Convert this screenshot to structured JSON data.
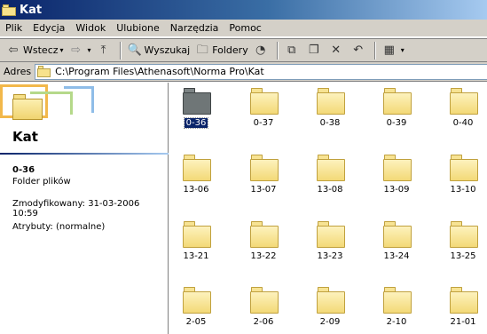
{
  "window": {
    "title": "Kat"
  },
  "menu": [
    {
      "label": "Plik"
    },
    {
      "label": "Edycja"
    },
    {
      "label": "Widok"
    },
    {
      "label": "Ulubione"
    },
    {
      "label": "Narzędzia"
    },
    {
      "label": "Pomoc"
    }
  ],
  "toolbar": {
    "back_label": "Wstecz",
    "search_label": "Wyszukaj",
    "folders_label": "Foldery"
  },
  "address": {
    "label": "Adres",
    "value": "C:\\Program Files\\Athenasoft\\Norma Pro\\Kat"
  },
  "details": {
    "folder_name": "Kat",
    "selected_name": "0-36",
    "selected_type": "Folder plików",
    "modified": "Zmodyfikowany: 31-03-2006 10:59",
    "attributes": "Atrybuty: (normalne)"
  },
  "folders": [
    [
      "0-36",
      "0-37",
      "0-38",
      "0-39",
      "0-40"
    ],
    [
      "13-06",
      "13-07",
      "13-08",
      "13-09",
      "13-10"
    ],
    [
      "13-21",
      "13-22",
      "13-23",
      "13-24",
      "13-25"
    ],
    [
      "2-05",
      "2-06",
      "2-09",
      "2-10",
      "21-01"
    ]
  ],
  "selected_folder": "0-36"
}
